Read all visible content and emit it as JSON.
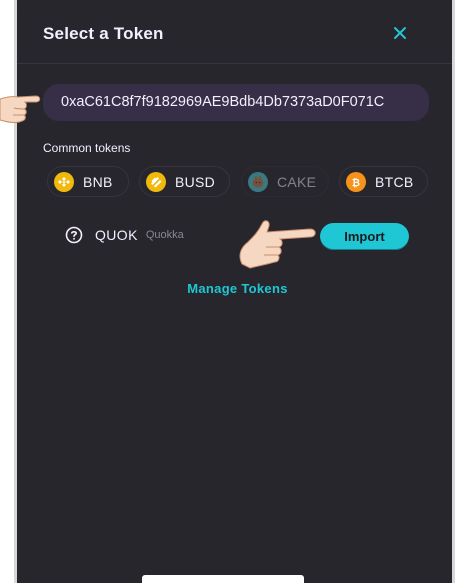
{
  "modal": {
    "title": "Select a Token",
    "close_icon": "close-icon"
  },
  "search": {
    "value": "0xaC61C8f7f9182969AE9Bdb4Db7373aD0F071C"
  },
  "common_tokens": {
    "label": "Common tokens",
    "items": [
      {
        "symbol": "BNB",
        "icon": "bnb-icon",
        "color": "#f0b90b",
        "disabled": false
      },
      {
        "symbol": "BUSD",
        "icon": "busd-icon",
        "color": "#f0b90b",
        "disabled": false
      },
      {
        "symbol": "CAKE",
        "icon": "cake-icon",
        "color": "#d1884f",
        "disabled": true
      },
      {
        "symbol": "BTCB",
        "icon": "btcb-icon",
        "color": "#f7931a",
        "disabled": false
      }
    ]
  },
  "result": {
    "symbol": "QUOK",
    "name": "Quokka",
    "import_label": "Import",
    "help_icon": "question-icon"
  },
  "manage_label": "Manage Tokens",
  "colors": {
    "background": "#27262c",
    "input": "#372f47",
    "accent": "#1fc7d4",
    "text": "#f4eeff",
    "muted": "#8a8592"
  }
}
